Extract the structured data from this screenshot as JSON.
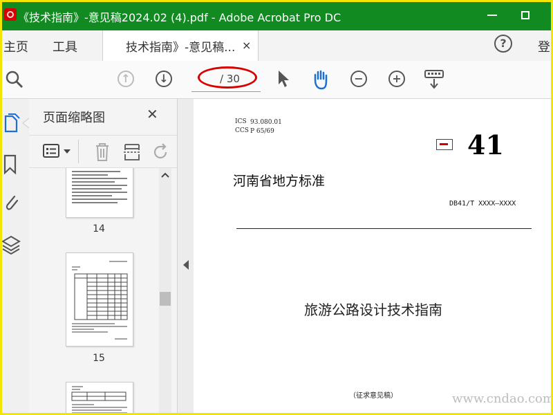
{
  "window": {
    "title": "《技术指南》-意见稿2024.02 (4).pdf - Adobe Acrobat Pro DC"
  },
  "menu": {
    "home": "主页",
    "tools": "工具",
    "doc_tab": "技术指南》-意见稿...",
    "doc_tab_close": "×",
    "help": "?",
    "signin": "登"
  },
  "toolbar": {
    "page_count": "/ 30"
  },
  "panel": {
    "title": "页面缩略图",
    "close": "✕",
    "thumbnails": [
      {
        "label": "14"
      },
      {
        "label": "15"
      },
      {
        "label": ""
      }
    ]
  },
  "document": {
    "ics_label": "ICS",
    "ics_value": "93.080.01",
    "ccs_label": "CCS",
    "ccs_value": "P 65/69",
    "standard_number": "41",
    "heading": "河南省地方标准",
    "db_code": "DB41/T XXXX—XXXX",
    "title": "旅游公路设计技术指南",
    "draft_note": "（征求意见稿）"
  },
  "watermark": {
    "text": "www.cndao.com"
  },
  "colors": {
    "titlebar": "#128a22",
    "frame": "#f2e600",
    "annotation": "#d80000"
  }
}
